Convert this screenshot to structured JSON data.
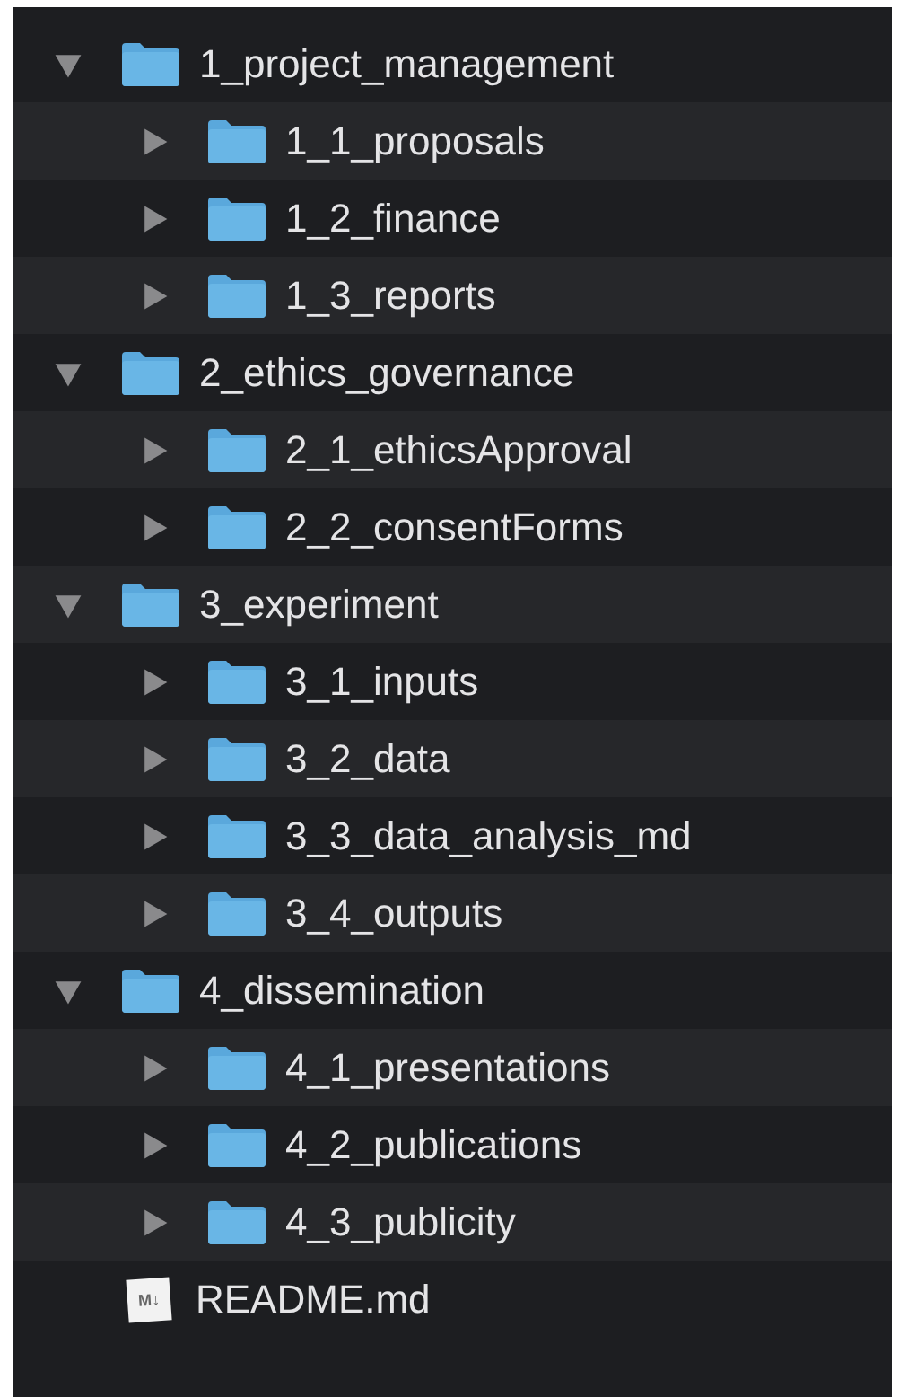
{
  "tree": [
    {
      "kind": "folder",
      "name": "1_project_management",
      "expanded": true,
      "children": [
        {
          "kind": "folder",
          "name": "1_1_proposals",
          "expanded": false
        },
        {
          "kind": "folder",
          "name": "1_2_finance",
          "expanded": false
        },
        {
          "kind": "folder",
          "name": "1_3_reports",
          "expanded": false
        }
      ]
    },
    {
      "kind": "folder",
      "name": "2_ethics_governance",
      "expanded": true,
      "children": [
        {
          "kind": "folder",
          "name": "2_1_ethicsApproval",
          "expanded": false
        },
        {
          "kind": "folder",
          "name": "2_2_consentForms",
          "expanded": false
        }
      ]
    },
    {
      "kind": "folder",
      "name": "3_experiment",
      "expanded": true,
      "children": [
        {
          "kind": "folder",
          "name": "3_1_inputs",
          "expanded": false
        },
        {
          "kind": "folder",
          "name": "3_2_data",
          "expanded": false
        },
        {
          "kind": "folder",
          "name": "3_3_data_analysis_md",
          "expanded": false
        },
        {
          "kind": "folder",
          "name": "3_4_outputs",
          "expanded": false
        }
      ]
    },
    {
      "kind": "folder",
      "name": "4_dissemination",
      "expanded": true,
      "children": [
        {
          "kind": "folder",
          "name": "4_1_presentations",
          "expanded": false
        },
        {
          "kind": "folder",
          "name": "4_2_publications",
          "expanded": false
        },
        {
          "kind": "folder",
          "name": "4_3_publicity",
          "expanded": false
        }
      ]
    },
    {
      "kind": "markdown",
      "name": "README.md",
      "badge": "M↓"
    }
  ]
}
